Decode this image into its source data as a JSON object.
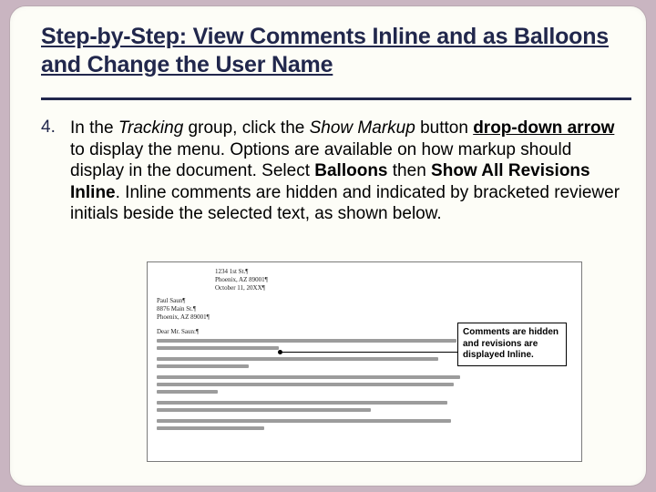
{
  "heading": "Step-by-Step: View Comments Inline and as Balloons and Change the User Name",
  "step_number": "4.",
  "step": {
    "pre1": "In the ",
    "tracking": "Tracking",
    "mid1": " group, click the ",
    "show_markup": "Show Markup",
    "mid2": " button ",
    "dropdown": "drop-down arrow",
    "mid3": " to display the menu. Options are available on how markup should display in the document. Select ",
    "balloons": "Balloons",
    "then": " then ",
    "show_all": "Show All Revisions Inline",
    "tail": ". Inline comments are hidden and indicated by bracketed reviewer initials beside the selected text, as shown below."
  },
  "preview": {
    "addr_right_l1": "1234 1st St.¶",
    "addr_right_l2": "Phoenix, AZ 89001¶",
    "addr_right_l3": "October 11, 20XX¶",
    "addr_left_l1": "Paul Saun¶",
    "addr_left_l2": "8876 Main St.¶",
    "addr_left_l3": "Phoenix, AZ 89001¶",
    "greeting": "Dear Mr. Saun:¶",
    "callout": "Comments are hidden and revisions are displayed Inline."
  }
}
